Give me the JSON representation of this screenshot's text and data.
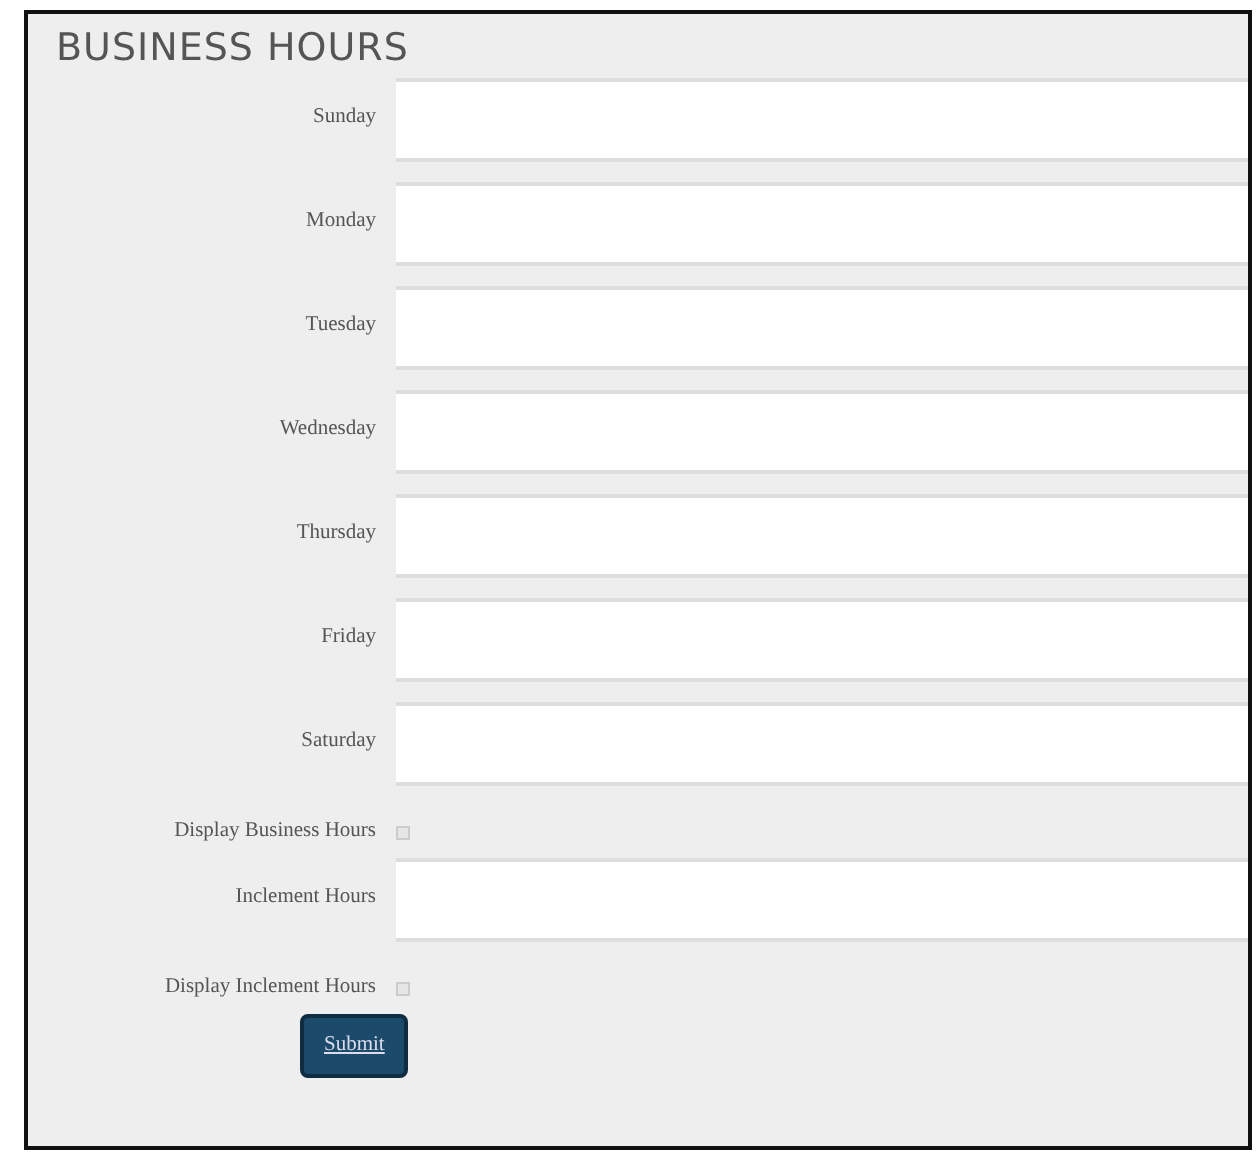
{
  "title": "BUSINESS HOURS",
  "fields": [
    {
      "kind": "text",
      "label": "Sunday"
    },
    {
      "kind": "text",
      "label": "Monday"
    },
    {
      "kind": "text",
      "label": "Tuesday"
    },
    {
      "kind": "text",
      "label": "Wednesday"
    },
    {
      "kind": "text",
      "label": "Thursday"
    },
    {
      "kind": "text",
      "label": "Friday"
    },
    {
      "kind": "text",
      "label": "Saturday"
    },
    {
      "kind": "checkbox",
      "label": "Display Business Hours",
      "checked": false
    },
    {
      "kind": "text",
      "label": "Inclement Hours"
    },
    {
      "kind": "checkbox",
      "label": "Display Inclement Hours",
      "checked": false
    }
  ],
  "submit": "Submit"
}
